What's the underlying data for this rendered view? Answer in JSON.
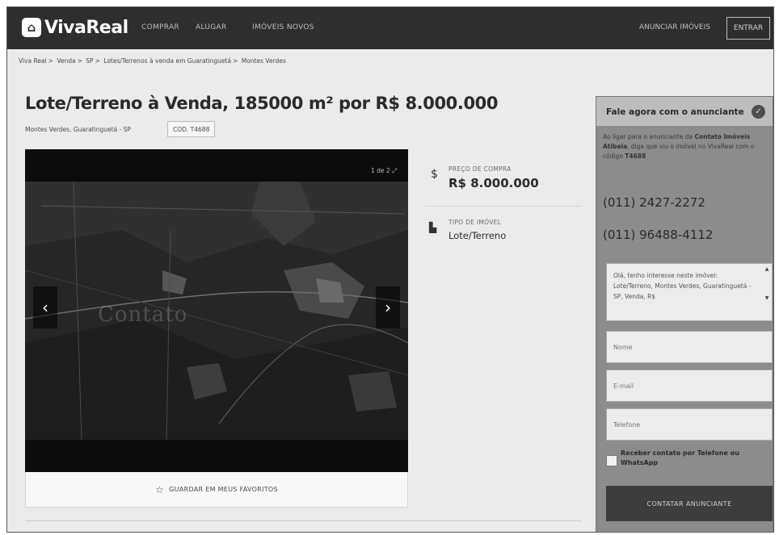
{
  "header": {
    "logo_text": "VivaReal",
    "nav": [
      "COMPRAR",
      "ALUGAR",
      "IMÓVEIS NOVOS"
    ],
    "anunciar": "ANUNCIAR IMÓVEIS",
    "entrar": "ENTRAR"
  },
  "breadcrumb": [
    "Viva Real",
    "Venda",
    "SP",
    "Lotes/Terrenos à venda em Guaratinguetá",
    "Montes Verdes"
  ],
  "listing": {
    "title": "Lote/Terreno à Venda, 185000 m² por R$ 8.000.000",
    "location": "Montes Verdes, Guaratinguetá - SP",
    "code": "COD. T4688"
  },
  "gallery": {
    "counter": "1 de 2",
    "watermark": "Contato",
    "favorite_label": "GUARDAR EM MEUS FAVORITOS"
  },
  "info": {
    "price_label": "PREÇO DE COMPRA",
    "price_value": "R$ 8.000.000",
    "type_label": "TIPO DE IMÓVEL",
    "type_value": "Lote/Terreno"
  },
  "contact": {
    "title": "Fale agora com o anunciante",
    "msg_prefix": "Ao ligar para o anunciante da",
    "msg_company": "Contato Imóveis Atibaia",
    "msg_middle": ", diga que viu o imóvel no VivaReal com o código",
    "msg_code": "T4688",
    "phone_1": "(011) 2427-2272",
    "phone_2": "(011) 96488-4112",
    "message": "Olá, tenho interesse neste imóvel: Lote/Terreno, Montes Verdes, Guaratinguetá - SP, Venda, R$",
    "nome_placeholder": "Nome",
    "email_placeholder": "E-mail",
    "telefone_placeholder": "Telefone",
    "whatsapp_prefix": "Receber contato por",
    "whatsapp_telefone": "Telefone",
    "whatsapp_ou": "ou",
    "whatsapp_app": "WhatsApp",
    "submit": "CONTATAR ANUNCIANTE"
  }
}
